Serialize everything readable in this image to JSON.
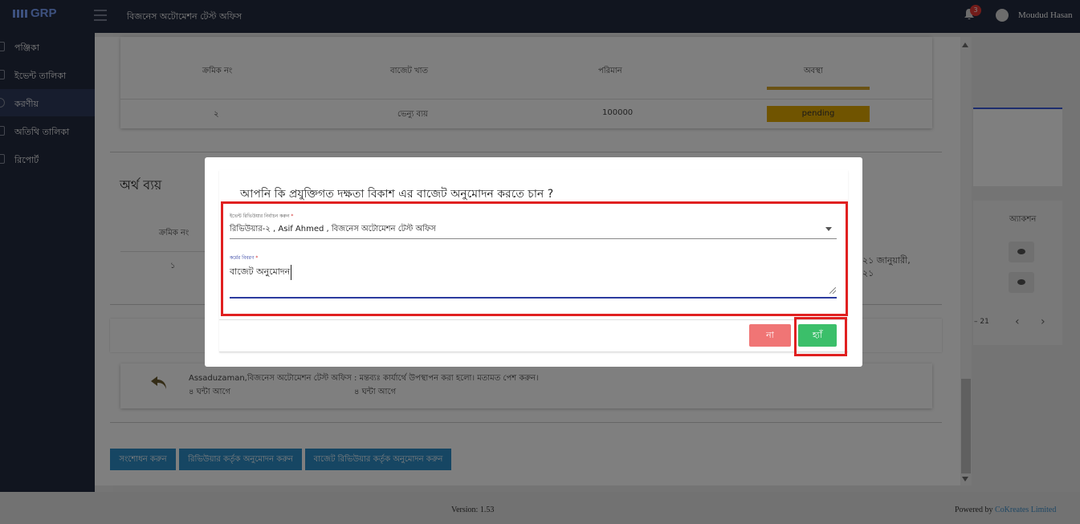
{
  "header": {
    "logo": "GRP",
    "org_name": "বিজনেস অটোমেশন টেস্ট অফিস",
    "notification_count": "3",
    "user_name": "Moudud Hasan"
  },
  "sidebar": {
    "items": [
      {
        "label": "পঞ্জিকা"
      },
      {
        "label": "ইভেন্ট তালিকা"
      },
      {
        "label": "করণীয়",
        "active": true
      },
      {
        "label": "অতিথি তালিকা"
      },
      {
        "label": "রিপোর্ট"
      }
    ]
  },
  "budget_table": {
    "headers": [
      "ক্রমিক নং",
      "বাজেট খাত",
      "পরিমান",
      "অবস্থা"
    ],
    "row": {
      "serial": "২",
      "sector": "ভেন্যু ব্যয়",
      "amount": "100000",
      "status": "pending"
    }
  },
  "expense": {
    "title": "অর্থ ব্যয়",
    "header_serial": "ক্রমিক নং",
    "row_serial": "১",
    "date_text_1": "২১ জানুয়ারী,",
    "date_text_2": "২১"
  },
  "background_table": {
    "action_header": "অ্যাকশন",
    "pagination_text": "– 21"
  },
  "comment": {
    "author_text": "Assaduzaman,বিজনেস অটোমেশন টেস্ট অফিস",
    "message": ": মন্তব্যঃ কার্যার্থে উপস্থাপন করা হলো। মতামত পেশ করুন।",
    "time_1": "৪ ঘন্টা আগে",
    "time_2": "৪ ঘন্টা আগে"
  },
  "actions": {
    "correct": "সংশোধন করুন",
    "reviewer_approve": "রিভিউয়ার কর্তৃক অনুমোদন করুন",
    "budget_reviewer_approve": "বাজেট রিভিউয়ার কর্তৃক অনুমোদন করুন"
  },
  "modal": {
    "question": "আপনি কি প্রযুক্তিগত দক্ষতা বিকাশ এর বাজেট অনুমোদন করতে চান ?",
    "select_label": "ইভেন্ট রিভিউয়ার নির্বাচন করুন",
    "select_value": "রিভিউয়ার-২ , Asif Ahmed , বিজনেস অটোমেশন টেস্ট অফিস",
    "textarea_label": "কর্মের বিবরণ",
    "textarea_value": "বাজেট অনুমোদন",
    "required_mark": "*",
    "no_label": "না",
    "yes_label": "হ্যাঁ"
  },
  "footer": {
    "version": "Version: 1.53",
    "powered_by": "Powered by",
    "company": "CoKreates Limited"
  },
  "colors": {
    "navbar": "#232a3e",
    "status": "#e0a800",
    "no_button": "#f07575",
    "yes_button": "#3bbf6a",
    "highlight": "#e02020",
    "action_button": "#2d8cc6"
  }
}
